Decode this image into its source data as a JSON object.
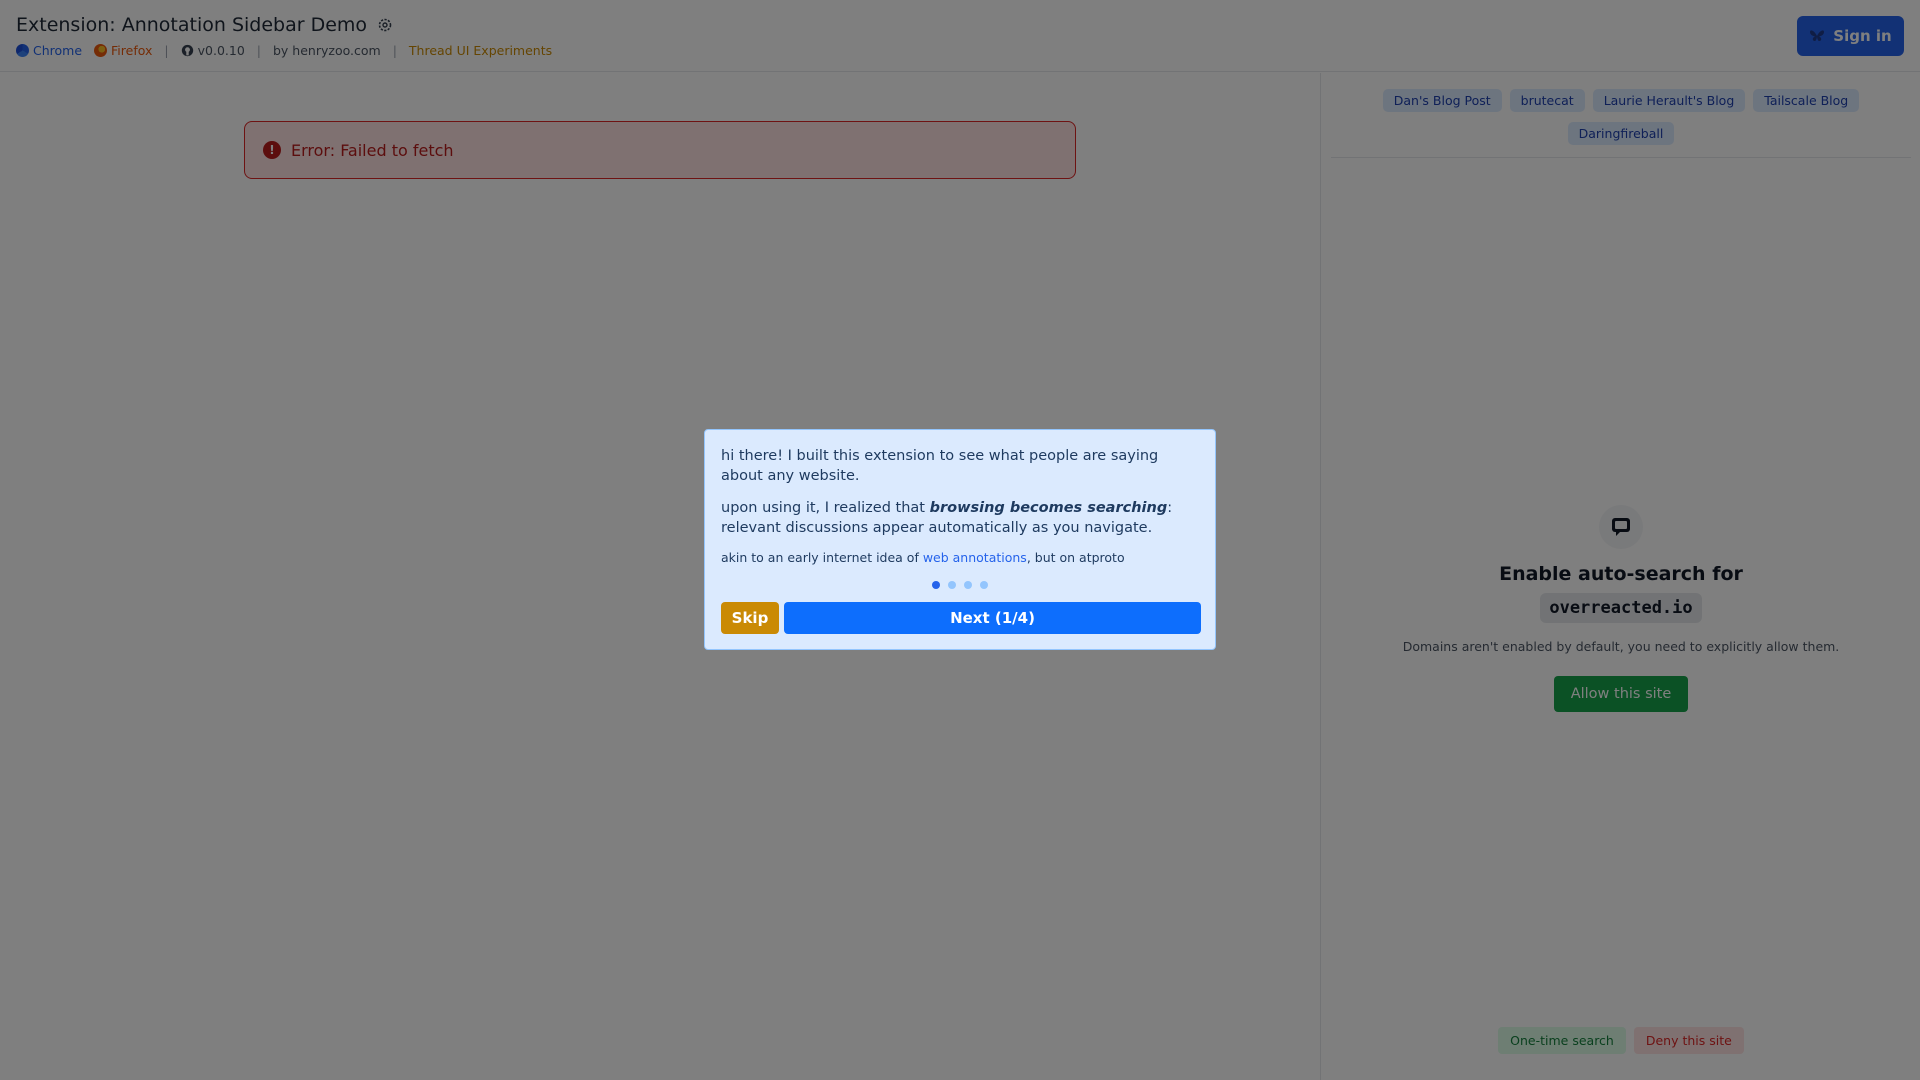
{
  "header": {
    "title": "Extension: Annotation Sidebar Demo",
    "settings_icon": "gear-icon",
    "links": {
      "chrome": "Chrome",
      "firefox": "Firefox",
      "version": "v0.0.10",
      "author": "by henryzoo.com",
      "thread": "Thread UI Experiments"
    },
    "sign_in": "Sign in",
    "sign_in_icon": "butterfly-icon"
  },
  "main": {
    "error": "Error: Failed to fetch"
  },
  "sidebar": {
    "chips": [
      "Dan's Blog Post",
      "brutecat",
      "Laurie Herault's Blog",
      "Tailscale Blog",
      "Daringfireball"
    ],
    "enable_title": "Enable auto-search for",
    "domain": "overreacted.io",
    "description": "Domains aren't enabled by default, you need to explicitly allow them.",
    "allow_button": "Allow this site",
    "one_time_button": "One-time search",
    "deny_button": "Deny this site"
  },
  "modal": {
    "p1": "hi there! I built this extension to see what people are saying about any website.",
    "p2_before": "upon using it, I realized that ",
    "p2_emphasis": "browsing becomes searching",
    "p2_after": ": relevant discussions appear automatically as you navigate.",
    "small_before": "akin to an early internet idea of ",
    "small_link": "web annotations",
    "small_after": ", but on atproto",
    "skip": "Skip",
    "next": "Next (1/4)",
    "step": 1,
    "total_steps": 4
  },
  "colors": {
    "primary": "#2563eb",
    "error": "#dc2626",
    "success": "#16a34a",
    "warning": "#ca8a04"
  }
}
